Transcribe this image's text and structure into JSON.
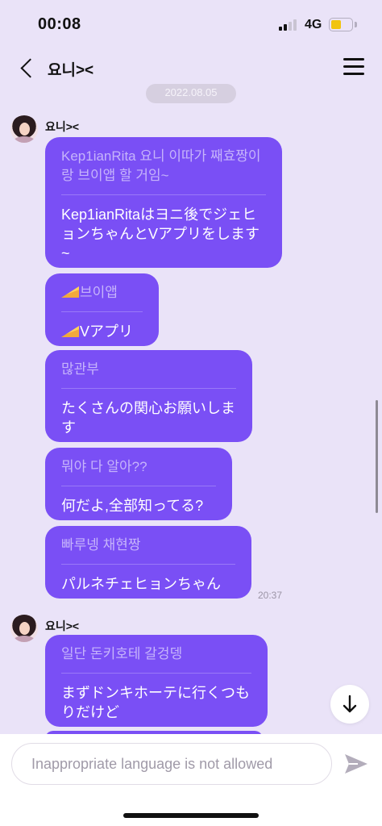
{
  "status_bar": {
    "time": "00:08",
    "network": "4G",
    "battery_level": 0.52,
    "signal_bars_on": 2,
    "signal_bars_total": 4
  },
  "header": {
    "title": "요니><"
  },
  "date_separator": "2022.08.05",
  "groups": [
    {
      "sender": "요니><",
      "messages": [
        {
          "kr": "Kep1ianRita 요니 이따가 째효짱이랑 브이앱 할 거임~",
          "jp": "Kep1ianRitaはヨニ後でジェヒョンちゃんとVアプリをします~"
        },
        {
          "icon": "cheese-icon",
          "kr": "브이앱",
          "jp": "Vアプリ"
        },
        {
          "kr": "많관부",
          "jp": "たくさんの関心お願いします"
        },
        {
          "kr": "뭐야 다 알아??",
          "jp": "何だよ,全部知ってる?"
        },
        {
          "kr": "빠루넹 채현짱",
          "jp": "パルネチェヒョンちゃん"
        }
      ],
      "timestamp": "20:37"
    },
    {
      "sender": "요니><",
      "messages": [
        {
          "kr": "일단 돈키호테 갈겅뎅",
          "jp": "まずドンキホーテに行くつもりだけど"
        }
      ]
    }
  ],
  "composer": {
    "placeholder": "Inappropriate language is not allowed"
  },
  "colors": {
    "background": "#eae3f8",
    "bubble": "#7a4ff5",
    "bubble_translation_text": "#c6b4fb"
  }
}
